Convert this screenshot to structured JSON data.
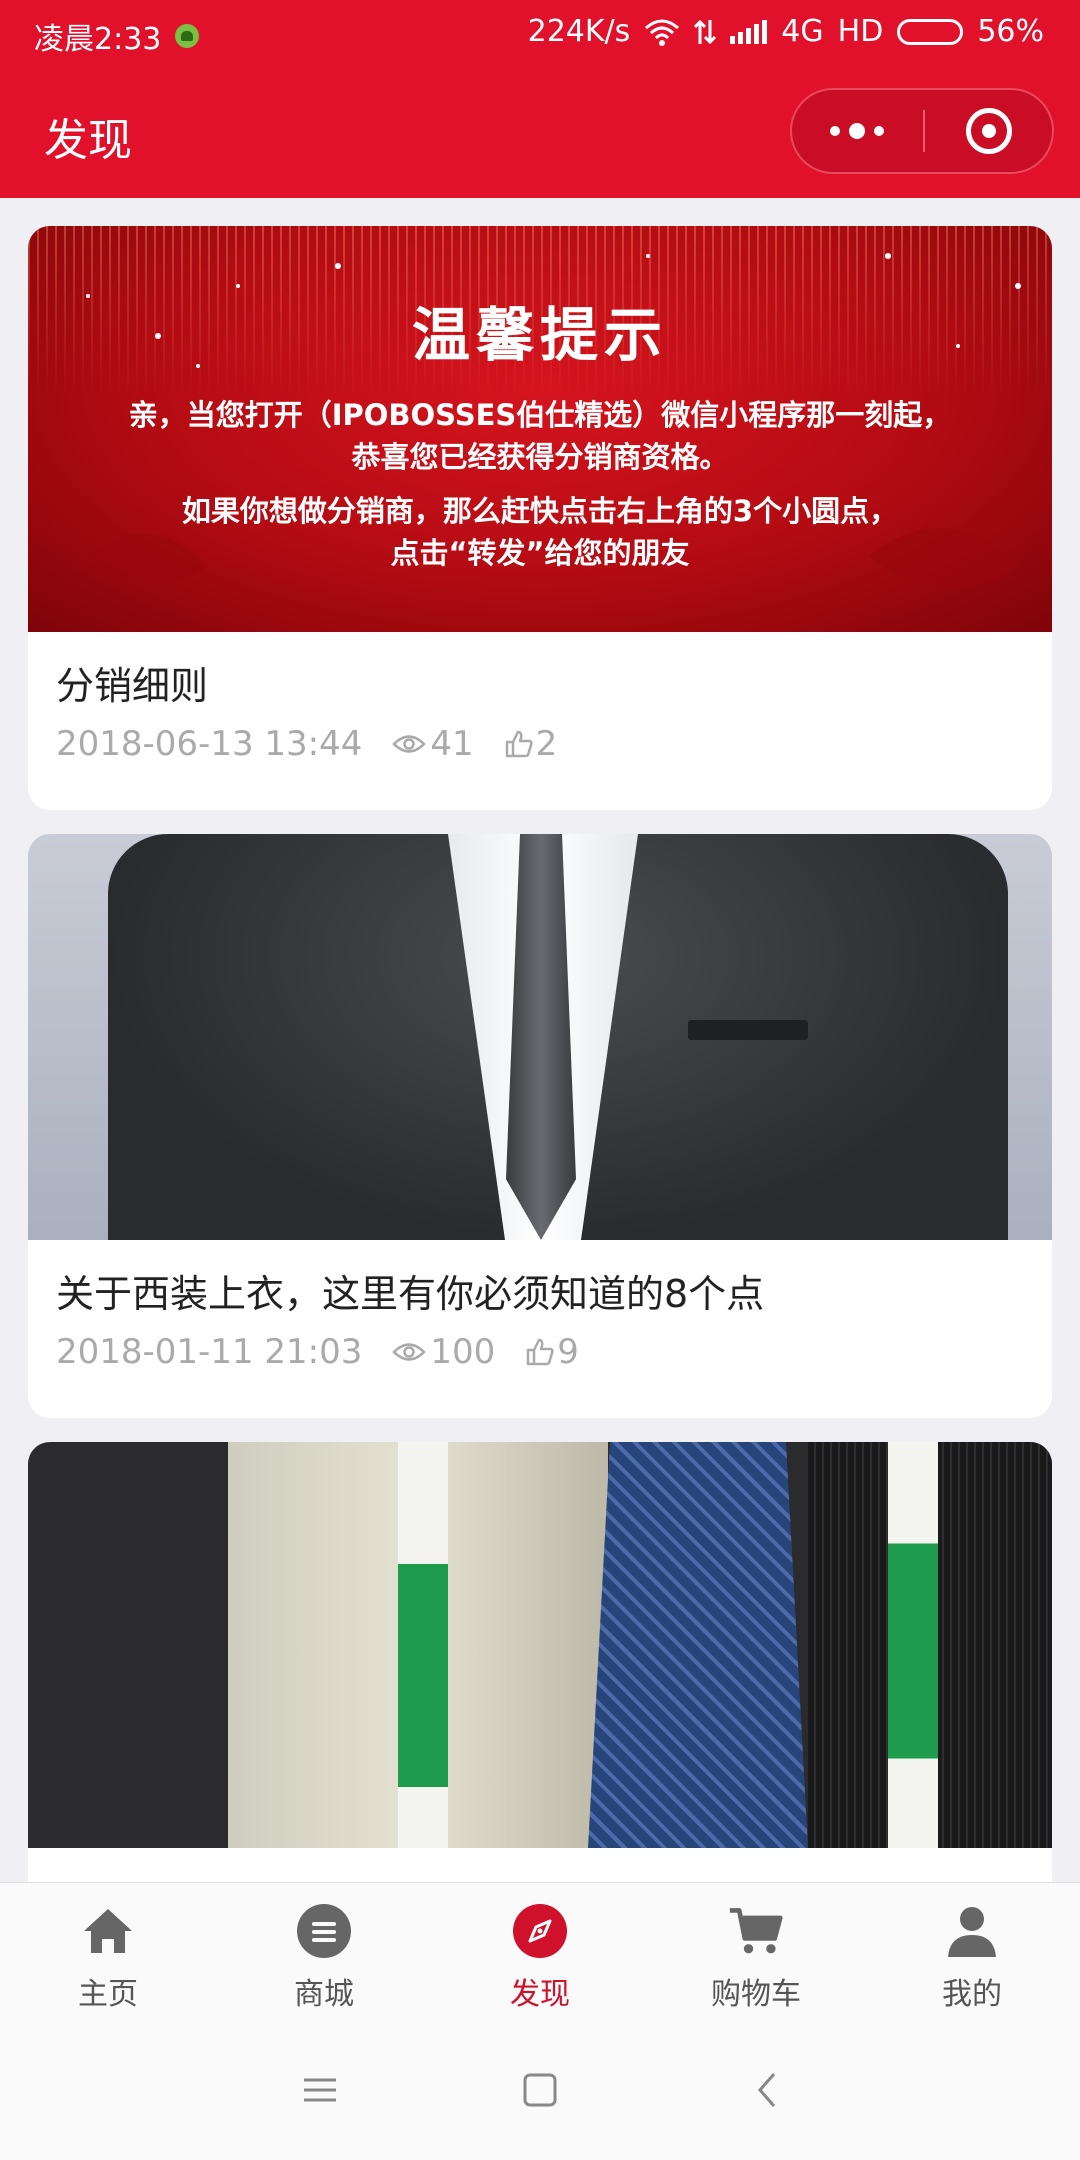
{
  "status_bar": {
    "time": "凌晨2:33",
    "speed": "224K/s",
    "network": "4G",
    "hd": "HD",
    "battery": "56%",
    "battery_level": 0.56
  },
  "nav": {
    "title": "发现"
  },
  "articles": [
    {
      "title": "分销细则",
      "date": "2018-06-13 13:44",
      "views": "41",
      "likes": "2",
      "banner": {
        "heading": "温馨提示",
        "line1": "亲，当您打开（IPOBOSSES伯仕精选）微信小程序那一刻起，",
        "line2": "恭喜您已经获得分销商资格。",
        "line3": "如果你想做分销商，那么赶快点击右上角的3个小圆点，",
        "line4": "点击“转发”给您的朋友"
      }
    },
    {
      "title": "关于西装上衣，这里有你必须知道的8个点",
      "date": "2018-01-11 21:03",
      "views": "100",
      "likes": "9"
    }
  ],
  "tabbar": {
    "items": [
      {
        "label": "主页",
        "icon": "home-icon"
      },
      {
        "label": "商城",
        "icon": "list-icon"
      },
      {
        "label": "发现",
        "icon": "compass-icon",
        "active": true
      },
      {
        "label": "购物车",
        "icon": "cart-icon"
      },
      {
        "label": "我的",
        "icon": "user-icon"
      }
    ]
  },
  "colors": {
    "brand": "#e1102b",
    "active_tab": "#d0112b",
    "meta_text": "#aaaaaa"
  }
}
